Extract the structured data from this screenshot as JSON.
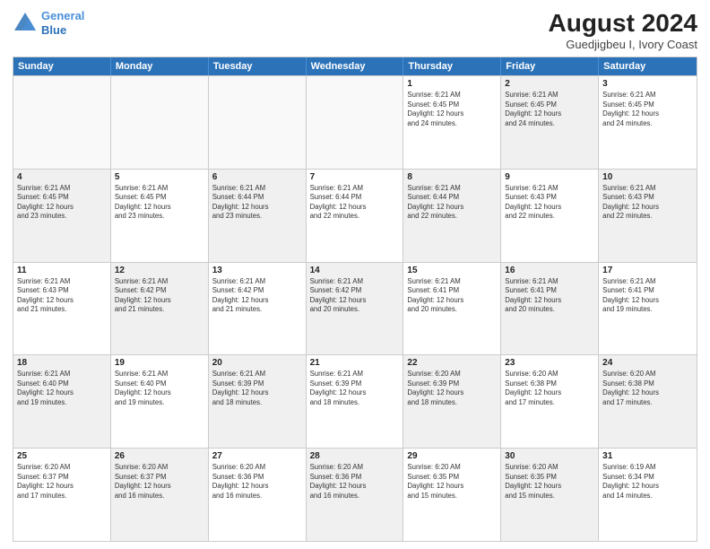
{
  "header": {
    "logo_line1": "General",
    "logo_line2": "Blue",
    "main_title": "August 2024",
    "sub_title": "Guedjigbeu I, Ivory Coast"
  },
  "weekdays": [
    "Sunday",
    "Monday",
    "Tuesday",
    "Wednesday",
    "Thursday",
    "Friday",
    "Saturday"
  ],
  "rows": [
    [
      {
        "day": "",
        "lines": [],
        "empty": true
      },
      {
        "day": "",
        "lines": [],
        "empty": true
      },
      {
        "day": "",
        "lines": [],
        "empty": true
      },
      {
        "day": "",
        "lines": [],
        "empty": true
      },
      {
        "day": "1",
        "lines": [
          "Sunrise: 6:21 AM",
          "Sunset: 6:45 PM",
          "Daylight: 12 hours",
          "and 24 minutes."
        ]
      },
      {
        "day": "2",
        "lines": [
          "Sunrise: 6:21 AM",
          "Sunset: 6:45 PM",
          "Daylight: 12 hours",
          "and 24 minutes."
        ],
        "shaded": true
      },
      {
        "day": "3",
        "lines": [
          "Sunrise: 6:21 AM",
          "Sunset: 6:45 PM",
          "Daylight: 12 hours",
          "and 24 minutes."
        ]
      }
    ],
    [
      {
        "day": "4",
        "lines": [
          "Sunrise: 6:21 AM",
          "Sunset: 6:45 PM",
          "Daylight: 12 hours",
          "and 23 minutes."
        ],
        "shaded": true
      },
      {
        "day": "5",
        "lines": [
          "Sunrise: 6:21 AM",
          "Sunset: 6:45 PM",
          "Daylight: 12 hours",
          "and 23 minutes."
        ]
      },
      {
        "day": "6",
        "lines": [
          "Sunrise: 6:21 AM",
          "Sunset: 6:44 PM",
          "Daylight: 12 hours",
          "and 23 minutes."
        ],
        "shaded": true
      },
      {
        "day": "7",
        "lines": [
          "Sunrise: 6:21 AM",
          "Sunset: 6:44 PM",
          "Daylight: 12 hours",
          "and 22 minutes."
        ]
      },
      {
        "day": "8",
        "lines": [
          "Sunrise: 6:21 AM",
          "Sunset: 6:44 PM",
          "Daylight: 12 hours",
          "and 22 minutes."
        ],
        "shaded": true
      },
      {
        "day": "9",
        "lines": [
          "Sunrise: 6:21 AM",
          "Sunset: 6:43 PM",
          "Daylight: 12 hours",
          "and 22 minutes."
        ]
      },
      {
        "day": "10",
        "lines": [
          "Sunrise: 6:21 AM",
          "Sunset: 6:43 PM",
          "Daylight: 12 hours",
          "and 22 minutes."
        ],
        "shaded": true
      }
    ],
    [
      {
        "day": "11",
        "lines": [
          "Sunrise: 6:21 AM",
          "Sunset: 6:43 PM",
          "Daylight: 12 hours",
          "and 21 minutes."
        ]
      },
      {
        "day": "12",
        "lines": [
          "Sunrise: 6:21 AM",
          "Sunset: 6:42 PM",
          "Daylight: 12 hours",
          "and 21 minutes."
        ],
        "shaded": true
      },
      {
        "day": "13",
        "lines": [
          "Sunrise: 6:21 AM",
          "Sunset: 6:42 PM",
          "Daylight: 12 hours",
          "and 21 minutes."
        ]
      },
      {
        "day": "14",
        "lines": [
          "Sunrise: 6:21 AM",
          "Sunset: 6:42 PM",
          "Daylight: 12 hours",
          "and 20 minutes."
        ],
        "shaded": true
      },
      {
        "day": "15",
        "lines": [
          "Sunrise: 6:21 AM",
          "Sunset: 6:41 PM",
          "Daylight: 12 hours",
          "and 20 minutes."
        ]
      },
      {
        "day": "16",
        "lines": [
          "Sunrise: 6:21 AM",
          "Sunset: 6:41 PM",
          "Daylight: 12 hours",
          "and 20 minutes."
        ],
        "shaded": true
      },
      {
        "day": "17",
        "lines": [
          "Sunrise: 6:21 AM",
          "Sunset: 6:41 PM",
          "Daylight: 12 hours",
          "and 19 minutes."
        ]
      }
    ],
    [
      {
        "day": "18",
        "lines": [
          "Sunrise: 6:21 AM",
          "Sunset: 6:40 PM",
          "Daylight: 12 hours",
          "and 19 minutes."
        ],
        "shaded": true
      },
      {
        "day": "19",
        "lines": [
          "Sunrise: 6:21 AM",
          "Sunset: 6:40 PM",
          "Daylight: 12 hours",
          "and 19 minutes."
        ]
      },
      {
        "day": "20",
        "lines": [
          "Sunrise: 6:21 AM",
          "Sunset: 6:39 PM",
          "Daylight: 12 hours",
          "and 18 minutes."
        ],
        "shaded": true
      },
      {
        "day": "21",
        "lines": [
          "Sunrise: 6:21 AM",
          "Sunset: 6:39 PM",
          "Daylight: 12 hours",
          "and 18 minutes."
        ]
      },
      {
        "day": "22",
        "lines": [
          "Sunrise: 6:20 AM",
          "Sunset: 6:39 PM",
          "Daylight: 12 hours",
          "and 18 minutes."
        ],
        "shaded": true
      },
      {
        "day": "23",
        "lines": [
          "Sunrise: 6:20 AM",
          "Sunset: 6:38 PM",
          "Daylight: 12 hours",
          "and 17 minutes."
        ]
      },
      {
        "day": "24",
        "lines": [
          "Sunrise: 6:20 AM",
          "Sunset: 6:38 PM",
          "Daylight: 12 hours",
          "and 17 minutes."
        ],
        "shaded": true
      }
    ],
    [
      {
        "day": "25",
        "lines": [
          "Sunrise: 6:20 AM",
          "Sunset: 6:37 PM",
          "Daylight: 12 hours",
          "and 17 minutes."
        ]
      },
      {
        "day": "26",
        "lines": [
          "Sunrise: 6:20 AM",
          "Sunset: 6:37 PM",
          "Daylight: 12 hours",
          "and 16 minutes."
        ],
        "shaded": true
      },
      {
        "day": "27",
        "lines": [
          "Sunrise: 6:20 AM",
          "Sunset: 6:36 PM",
          "Daylight: 12 hours",
          "and 16 minutes."
        ]
      },
      {
        "day": "28",
        "lines": [
          "Sunrise: 6:20 AM",
          "Sunset: 6:36 PM",
          "Daylight: 12 hours",
          "and 16 minutes."
        ],
        "shaded": true
      },
      {
        "day": "29",
        "lines": [
          "Sunrise: 6:20 AM",
          "Sunset: 6:35 PM",
          "Daylight: 12 hours",
          "and 15 minutes."
        ]
      },
      {
        "day": "30",
        "lines": [
          "Sunrise: 6:20 AM",
          "Sunset: 6:35 PM",
          "Daylight: 12 hours",
          "and 15 minutes."
        ],
        "shaded": true
      },
      {
        "day": "31",
        "lines": [
          "Sunrise: 6:19 AM",
          "Sunset: 6:34 PM",
          "Daylight: 12 hours",
          "and 14 minutes."
        ]
      }
    ]
  ]
}
